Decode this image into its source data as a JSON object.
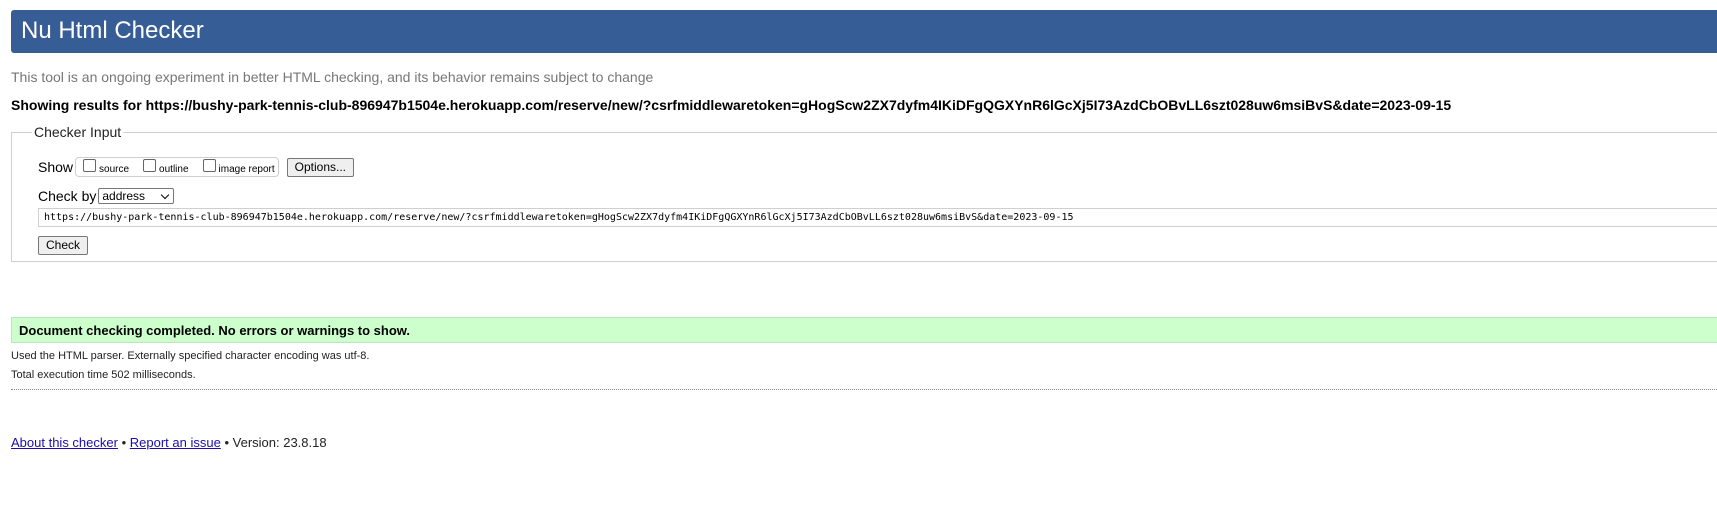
{
  "header": {
    "title": "Nu Html Checker"
  },
  "tagline": "This tool is an ongoing experiment in better HTML checking, and its behavior remains subject to change",
  "showing_results": "Showing results for https://bushy-park-tennis-club-896947b1504e.herokuapp.com/reserve/new/?csrfmiddlewaretoken=gHogScw2ZX7dyfm4IKiDFgQGXYnR6lGcXj5I73AzdCbOBvLL6szt028uw6msiBvS&date=2023-09-15",
  "checker_input": {
    "legend": "Checker Input",
    "show_label": "Show",
    "show_options": [
      {
        "label": "source",
        "checked": false
      },
      {
        "label": "outline",
        "checked": false
      },
      {
        "label": "image report",
        "checked": false
      }
    ],
    "options_button": "Options...",
    "check_by_label": "Check by",
    "check_by_value": "address",
    "url_value": "https://bushy-park-tennis-club-896947b1504e.herokuapp.com/reserve/new/?csrfmiddlewaretoken=gHogScw2ZX7dyfm4IKiDFgQGXYnR6lGcXj5I73AzdCbOBvLL6szt028uw6msiBvS&date=2023-09-15",
    "check_button": "Check"
  },
  "result": {
    "success_message": "Document checking completed. No errors or warnings to show.",
    "parser_info": "Used the HTML parser. Externally specified character encoding was utf-8.",
    "execution_time": "Total execution time 502 milliseconds."
  },
  "footer": {
    "about_link": "About this checker",
    "separator": "•",
    "report_link": "Report an issue",
    "version": "Version: 23.8.18"
  },
  "colors": {
    "header_bg": "#365d95",
    "success_bg": "#ccffcc",
    "link": "#1a0dab"
  }
}
